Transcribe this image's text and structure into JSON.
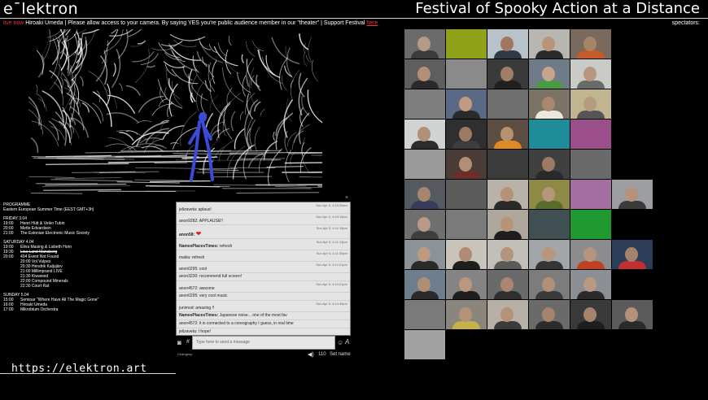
{
  "header": {
    "logo": "e¯lektron",
    "title": "Festival of Spooky Action at a Distance"
  },
  "ticker": {
    "live_label": "live now",
    "message": " Hiroaki Umeda | Please allow access to your camera. By saying YES you're public audience member in our \"theater\" | Support Festival ",
    "link_text": "here"
  },
  "spectators_label": "spectators:",
  "program": {
    "heading": "PROGRAMME",
    "timezone": "Eastern European Summer Time (EEST GMT+3h)",
    "days": [
      {
        "label": "FRIDAY 3.04",
        "items": [
          {
            "time": "19:00",
            "title": "Henri Hütt & Veiko Tubin",
            "struck": false
          },
          {
            "time": "20:00",
            "title": "Mette Edvardsen",
            "struck": false
          },
          {
            "time": "21:00",
            "title": "The Estonian Electronic Music Society",
            "struck": false
          }
        ]
      },
      {
        "label": "SATURDAY 4.04",
        "items": [
          {
            "time": "19:00",
            "title": "Elina Masing & Lisbeth Horn",
            "struck": false
          },
          {
            "time": "19:30",
            "title": "Lisa Lund Mansberg",
            "struck": true
          },
          {
            "time": "20:00",
            "title": "404 Event Not Found",
            "struck": false
          },
          {
            "time": "",
            "title": "20:00 Vol Vulpes",
            "struck": false
          },
          {
            "time": "",
            "title": "20:30 Hendrik Kaljujärv",
            "struck": false
          },
          {
            "time": "",
            "title": "21:00 Millimprand LIVE",
            "struck": false
          },
          {
            "time": "",
            "title": "21:30 Kiwanoid",
            "struck": false
          },
          {
            "time": "",
            "title": "22:00 Compound Minerals",
            "struck": false
          },
          {
            "time": "",
            "title": "22:30 Court Rat",
            "struck": false
          }
        ]
      },
      {
        "label": "SUNDAY 5.04",
        "items": [
          {
            "time": "15:00",
            "title": "Seminar \"Where Have All The Magic Gone\"",
            "struck": false
          },
          {
            "time": "16:00",
            "title": "Hiroaki Umeda",
            "struck": false
          },
          {
            "time": "17:00",
            "title": "Mikrobium Orchestra",
            "struck": false
          }
        ]
      }
    ]
  },
  "url": "https://elektron.art",
  "chat": {
    "messages": [
      {
        "user": "jelizaveta:",
        "text": " aplaus!",
        "ts": "Sun Apr 5, 4:15:39am",
        "bold_user": false,
        "heart": false
      },
      {
        "user": "anon9282:",
        "text": " APPLAUSE!!",
        "ts": "Sun Apr 5, 4:10:16pm",
        "bold_user": false,
        "heart": false
      },
      {
        "user": "anon58:",
        "text": " ",
        "ts": "Sun Apr 5, 4:11:15pm",
        "bold_user": true,
        "heart": true
      },
      {
        "user": "NamesPlacesTimes:",
        "text": " refresh",
        "ts": "Sun Apr 5, 4:11:13pm",
        "bold_user": true,
        "heart": false
      },
      {
        "user": "maiiia:",
        "text": " refresh",
        "ts": "Sun Apr 5, 4:11:30pm",
        "bold_user": false,
        "heart": false
      },
      {
        "user": "anon0295:",
        "text": " cool",
        "ts": "Sun Apr 5, 4:12:21pm",
        "bold_user": false,
        "heart": false
      },
      {
        "user": "anon3230:",
        "text": " recommend full screen!",
        "ts": "",
        "bold_user": false,
        "heart": false
      },
      {
        "user": "anon4572:",
        "text": " awsome",
        "ts": "Sun Apr 5, 4:13:21pm",
        "bold_user": false,
        "heart": false
      },
      {
        "user": "anon0295:",
        "text": " very cool music",
        "ts": "",
        "bold_user": false,
        "heart": false
      },
      {
        "user": "junimod:",
        "text": " amazing !!",
        "ts": "Sun Apr 5, 4:14:49pm",
        "bold_user": false,
        "heart": false
      },
      {
        "user": "NamesPlacesTimes:",
        "text": " Japanese noise... one of the most fav",
        "ts": "",
        "bold_user": true,
        "heart": false
      },
      {
        "user": "anon4572:",
        "text": " it is connected to a coreography I guess, in real time",
        "ts": "",
        "bold_user": false,
        "heart": false
      },
      {
        "user": "jelizaveta:",
        "text": " I hope!",
        "ts": "",
        "bold_user": false,
        "heart": false
      }
    ],
    "input_placeholder": "Type here to send a message",
    "changeup_label": "Changeup",
    "viewer_count": "110",
    "set_name_label": "Set name"
  },
  "icons": {
    "camera": "camera-icon",
    "hash": "hash-icon",
    "emoji": "emoji-icon",
    "font": "font-icon",
    "volume": "volume-icon",
    "close": "close-icon"
  },
  "colors": {
    "live": "#e33333",
    "page_bg": "#000000",
    "chat_bg": "#ededed",
    "heart": "#e02020"
  },
  "spectator_tiles": [
    {
      "bg": "#6b6b6b",
      "skin": "#b59a86",
      "shirt": "#3b3b3b",
      "person": true
    },
    {
      "bg": "#8fa21a",
      "skin": "#8fa21a",
      "shirt": "#8fa21a",
      "person": false
    },
    {
      "bg": "#b7c3c9",
      "skin": "#a07862",
      "shirt": "#2f3a46",
      "person": true
    },
    {
      "bg": "#b8b6b0",
      "skin": "#b89478",
      "shirt": "#2b2b2b",
      "person": true
    },
    {
      "bg": "#7a6a5e",
      "skin": "#a88467",
      "shirt": "#c55a2b",
      "person": true
    },
    {
      "bg": "#5e5e5e",
      "skin": "#b48f78",
      "shirt": "#2a2a2a",
      "person": true
    },
    {
      "bg": "#8a8a8a",
      "skin": "#8a8a8a",
      "shirt": "#8a8a8a",
      "person": false
    },
    {
      "bg": "#3a3a3a",
      "skin": "#9f7d66",
      "shirt": "#202020",
      "person": true
    },
    {
      "bg": "#6f7b86",
      "skin": "#c5a58c",
      "shirt": "#4a9a44",
      "person": true
    },
    {
      "bg": "#c9cbc7",
      "skin": "#b9977e",
      "shirt": "#6a6a6a",
      "person": true
    },
    {
      "bg": "#7f7f7f",
      "skin": "#7f7f7f",
      "shirt": "#7f7f7f",
      "person": false
    },
    {
      "bg": "#5a6a86",
      "skin": "#c09a82",
      "shirt": "#2a2a2a",
      "person": true
    },
    {
      "bg": "#6e6e6e",
      "skin": "#6e6e6e",
      "shirt": "#6e6e6e",
      "person": false
    },
    {
      "bg": "#7b7366",
      "skin": "#a8876e",
      "shirt": "#ece8dd",
      "person": true
    },
    {
      "bg": "#c0b58e",
      "skin": "#b89a80",
      "shirt": "#555555",
      "person": true
    },
    {
      "bg": "#d0d3d3",
      "skin": "#b28f77",
      "shirt": "#2c2c2c",
      "person": true
    },
    {
      "bg": "#2f2f2f",
      "skin": "#9d7a63",
      "shirt": "#3d3d3d",
      "person": true
    },
    {
      "bg": "#5d4e43",
      "skin": "#b6906f",
      "shirt": "#e08a22",
      "person": true
    },
    {
      "bg": "#1f8c9a",
      "skin": "#1f8c9a",
      "shirt": "#1f8c9a",
      "person": false
    },
    {
      "bg": "#9a4f8a",
      "skin": "#9a4f8a",
      "shirt": "#9a4f8a",
      "person": false
    },
    {
      "bg": "#9a9a9a",
      "skin": "#9a9a9a",
      "shirt": "#9a9a9a",
      "person": false
    },
    {
      "bg": "#4a3c36",
      "skin": "#b18e74",
      "shirt": "#6a2f2a",
      "person": true
    },
    {
      "bg": "#3c3c3c",
      "skin": "#3c3c3c",
      "shirt": "#3c3c3c",
      "person": false
    },
    {
      "bg": "#404040",
      "skin": "#9c7a64",
      "shirt": "#2a2a2a",
      "person": true
    },
    {
      "bg": "#6a6a6a",
      "skin": "#6a6a6a",
      "shirt": "#6a6a6a",
      "person": false
    },
    {
      "bg": "#555a60",
      "skin": "#a5866f",
      "shirt": "#3a3a5a",
      "person": true
    },
    {
      "bg": "#5c5c5c",
      "skin": "#5c5c5c",
      "shirt": "#5c5c5c",
      "person": false
    },
    {
      "bg": "#b9b2a8",
      "skin": "#b59178",
      "shirt": "#2a2a2a",
      "person": true
    },
    {
      "bg": "#8d8a46",
      "skin": "#b6977a",
      "shirt": "#5a6a2a",
      "person": true
    },
    {
      "bg": "#a36fa0",
      "skin": "#a36fa0",
      "shirt": "#a36fa0",
      "person": false
    },
    {
      "bg": "#9c9ea2",
      "skin": "#b5937a",
      "shirt": "#3a3a3a",
      "person": true
    },
    {
      "bg": "#6f6f6f",
      "skin": "#b89a86",
      "shirt": "#3e3e3e",
      "person": true
    },
    {
      "bg": "#7a7a7a",
      "skin": "#7a7a7a",
      "shirt": "#7a7a7a",
      "person": false
    },
    {
      "bg": "#ada79c",
      "skin": "#b79378",
      "shirt": "#1e1e1e",
      "person": true
    },
    {
      "bg": "#3f4f52",
      "skin": "#3f4f52",
      "shirt": "#3f4f52",
      "person": false
    },
    {
      "bg": "#1f9a30",
      "skin": "#1f9a30",
      "shirt": "#1f9a30",
      "person": false
    },
    {
      "bg": "#8c9398",
      "skin": "#bb9a80",
      "shirt": "#2a2a2a",
      "person": true
    },
    {
      "bg": "#c8c3bb",
      "skin": "#b08c74",
      "shirt": "#1e1e1e",
      "person": true
    },
    {
      "bg": "#c2bfb9",
      "skin": "#b4927b",
      "shirt": "#5a5a5a",
      "person": true
    },
    {
      "bg": "#a3a6a8",
      "skin": "#b7967c",
      "shirt": "#353535",
      "person": true
    },
    {
      "bg": "#8a8c8e",
      "skin": "#b6957e",
      "shirt": "#c04020",
      "person": true
    },
    {
      "bg": "#2c3d58",
      "skin": "#a4826b",
      "shirt": "#c23030",
      "person": true
    },
    {
      "bg": "#6d7f8e",
      "skin": "#b08e76",
      "shirt": "#2a2a2a",
      "person": true
    },
    {
      "bg": "#848484",
      "skin": "#b9987f",
      "shirt": "#1f1f1f",
      "person": true
    },
    {
      "bg": "#6a6a6a",
      "skin": "#aa8670",
      "shirt": "#2f2f2f",
      "person": true
    },
    {
      "bg": "#7c7c7c",
      "skin": "#b29078",
      "shirt": "#3a3a3a",
      "person": true
    },
    {
      "bg": "#8b8e92",
      "skin": "#b99982",
      "shirt": "#2a2a2a",
      "person": true
    },
    {
      "bg": "#7a7a7a",
      "skin": "#7a7a7a",
      "shirt": "#7a7a7a",
      "person": false
    },
    {
      "bg": "#8a867e",
      "skin": "#b69277",
      "shirt": "#c7b24a",
      "person": true
    },
    {
      "bg": "#b6b0a6",
      "skin": "#b69278",
      "shirt": "#3a3a3a",
      "person": true
    },
    {
      "bg": "#6a6a6a",
      "skin": "#a6846c",
      "shirt": "#2c2c2c",
      "person": true
    },
    {
      "bg": "#3a3a3a",
      "skin": "#a4826b",
      "shirt": "#1e1e1e",
      "person": true
    },
    {
      "bg": "#5b5b5b",
      "skin": "#b3917a",
      "shirt": "#2a2a2a",
      "person": true
    },
    {
      "bg": "#a2a2a2",
      "skin": "#a2a2a2",
      "shirt": "#a2a2a2",
      "person": false
    },
    {
      "bg": "#000000",
      "skin": "#000000",
      "shirt": "#000000",
      "person": false
    },
    {
      "bg": "#1f1f1f",
      "skin": "#a07e68",
      "shirt": "#1e1e1e",
      "person": true
    },
    {
      "bg": "#b3a79a",
      "skin": "#ad8b72",
      "shirt": "#2a3a6a",
      "person": true
    },
    {
      "bg": "#5a5a5a",
      "skin": "#b08f78",
      "shirt": "#2a2a2a",
      "person": true
    },
    {
      "bg": "#6e6e6e",
      "skin": "#b29279",
      "shirt": "#1a1a1a",
      "person": true
    },
    {
      "bg": "#4b4b4b",
      "skin": "#a8866e",
      "shirt": "#2a2a2a",
      "person": true
    },
    {
      "bg": "#c4c0bb",
      "skin": "#b6967e",
      "shirt": "#222222",
      "person": true
    },
    {
      "bg": "#8a8a8a",
      "skin": "#8a8a8a",
      "shirt": "#8a8a8a",
      "person": false
    }
  ]
}
